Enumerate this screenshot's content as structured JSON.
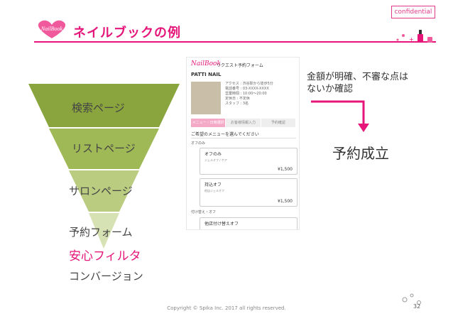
{
  "confidential_label": "confidential",
  "title": "ネイルブックの例",
  "logo_text": "NailBook",
  "funnel": {
    "steps": [
      "検索ページ",
      "リストページ",
      "サロンページ",
      "予約フォーム"
    ],
    "filter_label": "安心フィルタ",
    "conversion_label": "コンバージョン"
  },
  "screenshot": {
    "logo": "NailBook",
    "title": "リクエスト予約フォーム",
    "salon_name": "PATTI NAIL",
    "info_lines": [
      "アクセス : 渋谷駅から徒歩5分",
      "電話番号 : 03-XXXX-XXXX",
      "営業時間 : 10:00～20:00",
      "定休日 : 不定休",
      "スタッフ : 3名"
    ],
    "steps": [
      "メニュー・日時選択",
      "お客様情報入力",
      "予約確認"
    ],
    "section_heading": "ご希望のメニューを選んでください",
    "categories": [
      "オフのみ",
      "付け替え・オフ"
    ],
    "options": [
      {
        "name": "オフのみ",
        "detail": "ジェルオフ / ケア",
        "price": "¥1,500"
      },
      {
        "name": "持込オフ",
        "detail": "他店ジェルオフ",
        "price": "¥1,500"
      },
      {
        "name": "他店付け替えオフ",
        "detail": "",
        "price": ""
      }
    ]
  },
  "note": [
    "金額が明確、不審な点は",
    "ないか確認"
  ],
  "result": "予約成立",
  "footer": "Copyright © Spika Inc. 2017 all rights reserved.",
  "page_number": "32",
  "colors": {
    "accent": "#e5157a",
    "funnel_green": "#8aa53e"
  }
}
